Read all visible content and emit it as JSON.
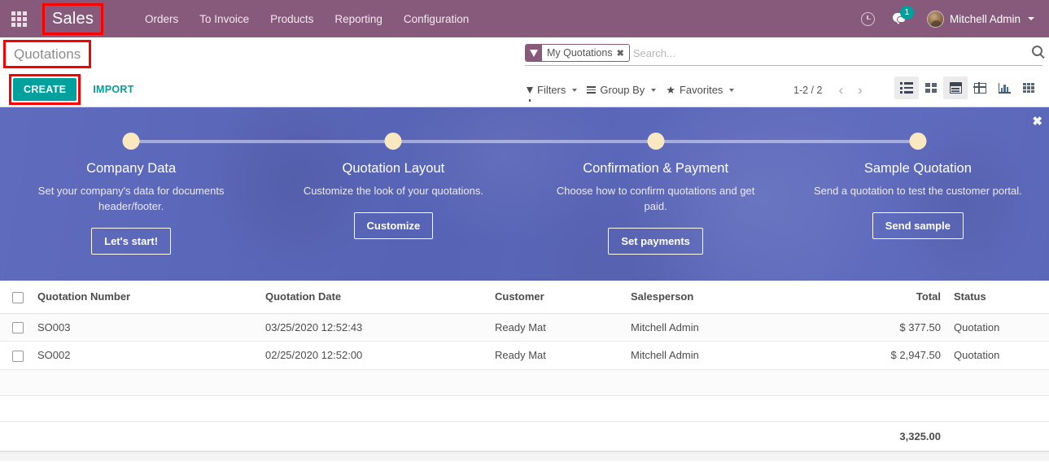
{
  "navbar": {
    "apps_icon": "apps-grid-icon",
    "brand": "Sales",
    "menu": [
      {
        "label": "Orders"
      },
      {
        "label": "To Invoice"
      },
      {
        "label": "Products"
      },
      {
        "label": "Reporting"
      },
      {
        "label": "Configuration"
      }
    ],
    "activity_icon": "clock-icon",
    "messages_icon": "chat-icon",
    "messages_badge": "1",
    "user_name": "Mitchell Admin",
    "brand_color": "#875A7B",
    "badge_color": "#00A09D"
  },
  "control_panel": {
    "title": "Quotations",
    "create_label": "CREATE",
    "import_label": "IMPORT",
    "create_color": "#00A09D",
    "search": {
      "facet_label": "My Quotations",
      "facet_remove": "✖",
      "placeholder": "Search...",
      "value": ""
    },
    "filters": [
      {
        "label": "Filters",
        "icon": "funnel-icon"
      },
      {
        "label": "Group By",
        "icon": "bars-icon"
      },
      {
        "label": "Favorites",
        "icon": "star-icon"
      }
    ],
    "pager": {
      "count": "1-2 / 2",
      "prev": "‹",
      "next": "›"
    },
    "views": [
      {
        "name": "list",
        "active": true
      },
      {
        "name": "kanban",
        "active": false
      },
      {
        "name": "calendar",
        "active": true
      },
      {
        "name": "pivot",
        "active": false
      },
      {
        "name": "graph",
        "active": false
      },
      {
        "name": "cohort",
        "active": false
      }
    ]
  },
  "banner": {
    "close": "✖",
    "steps": [
      {
        "title": "Company Data",
        "desc": "Set your company's data for documents header/footer.",
        "button": "Let's start!"
      },
      {
        "title": "Quotation Layout",
        "desc": "Customize the look of your quotations.",
        "button": "Customize"
      },
      {
        "title": "Confirmation & Payment",
        "desc": "Choose how to confirm quotations and get paid.",
        "button": "Set payments"
      },
      {
        "title": "Sample Quotation",
        "desc": "Send a quotation to test the customer portal.",
        "button": "Send sample"
      }
    ]
  },
  "list": {
    "columns": [
      "Quotation Number",
      "Quotation Date",
      "Customer",
      "Salesperson",
      "Total",
      "Status"
    ],
    "rows": [
      {
        "number": "SO003",
        "date": "03/25/2020 12:52:43",
        "customer": "Ready Mat",
        "salesperson": "Mitchell Admin",
        "total": "$ 377.50",
        "status": "Quotation"
      },
      {
        "number": "SO002",
        "date": "02/25/2020 12:52:00",
        "customer": "Ready Mat",
        "salesperson": "Mitchell Admin",
        "total": "$ 2,947.50",
        "status": "Quotation"
      }
    ],
    "total": "3,325.00"
  }
}
